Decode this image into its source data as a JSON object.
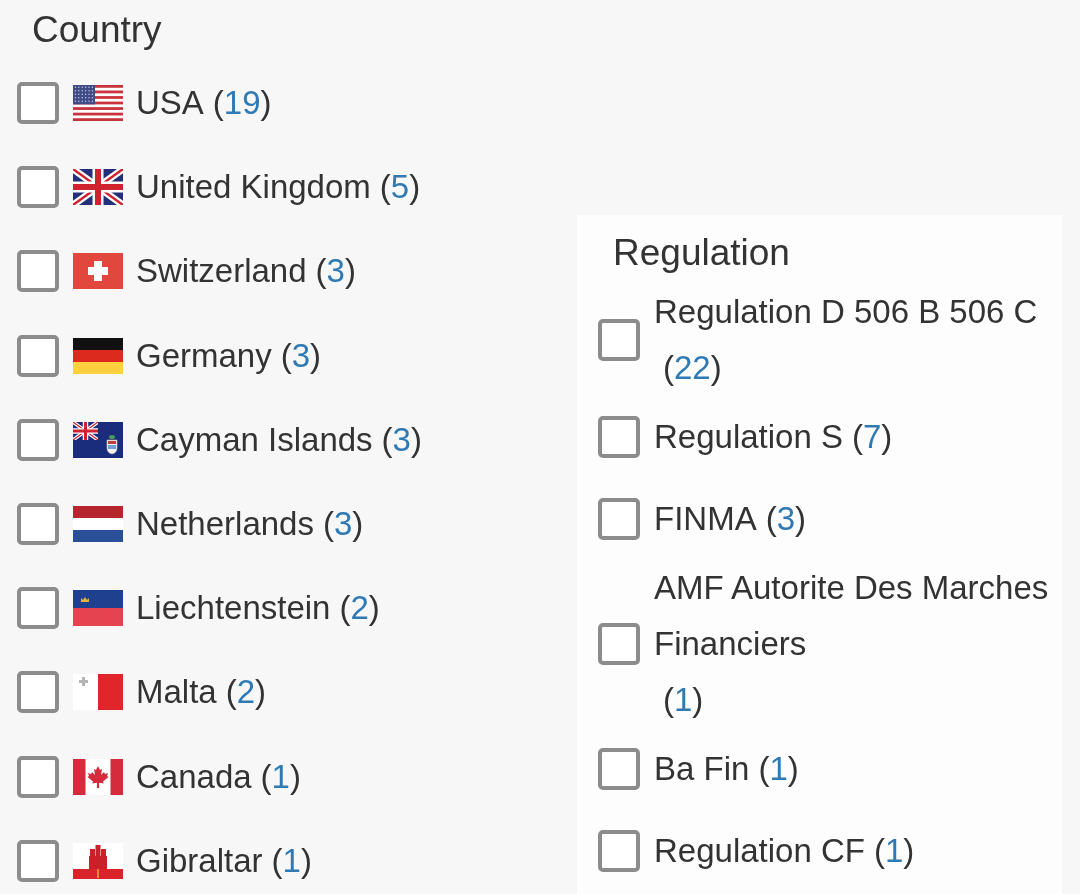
{
  "country_filter": {
    "title": "Country",
    "options": [
      {
        "label": "USA",
        "count": "(19)",
        "checked": false
      },
      {
        "label": "United Kingdom",
        "count": "(5)",
        "checked": false
      },
      {
        "label": "Switzerland",
        "count": "(3)",
        "checked": false
      },
      {
        "label": "Germany",
        "count": "(3)",
        "checked": false
      },
      {
        "label": "Cayman Islands",
        "count": "(3)",
        "checked": false
      },
      {
        "label": "Netherlands",
        "count": "(3)",
        "checked": false
      },
      {
        "label": "Liechtenstein",
        "count": "(2)",
        "checked": false
      },
      {
        "label": "Malta",
        "count": "(2)",
        "checked": false
      },
      {
        "label": "Canada",
        "count": "(1)",
        "checked": false
      },
      {
        "label": "Gibraltar",
        "count": "(1)",
        "checked": false
      }
    ]
  },
  "regulation_filter": {
    "title": "Regulation",
    "options": [
      {
        "label": "Regulation D 506 B 506 C",
        "count": "(22)",
        "checked": false
      },
      {
        "label": "Regulation S",
        "count": "(7)",
        "checked": false
      },
      {
        "label": "FINMA",
        "count": "(3)",
        "checked": false
      },
      {
        "label": "AMF Autorite Des Marches Financiers",
        "count": "(1)",
        "checked": false
      },
      {
        "label": "Ba Fin",
        "count": "(1)",
        "checked": false
      },
      {
        "label": "Regulation CF",
        "count": "(1)",
        "checked": false
      }
    ]
  }
}
